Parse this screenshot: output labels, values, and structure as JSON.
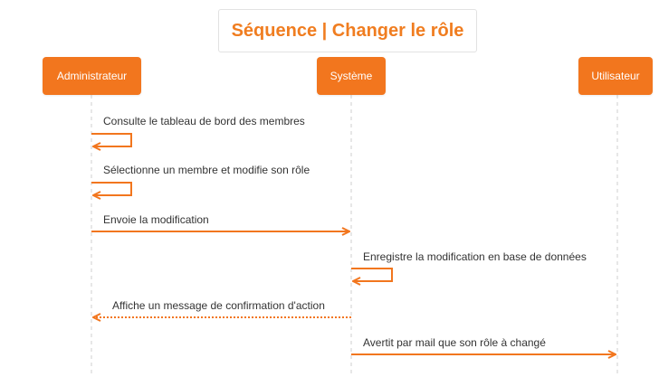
{
  "title": "Séquence | Changer le rôle",
  "participants": [
    {
      "id": "admin",
      "label": "Administrateur"
    },
    {
      "id": "system",
      "label": "Système"
    },
    {
      "id": "user",
      "label": "Utilisateur"
    }
  ],
  "messages": [
    {
      "from": "admin",
      "to": "admin",
      "type": "self",
      "style": "solid",
      "label": "Consulte le tableau de bord des membres"
    },
    {
      "from": "admin",
      "to": "admin",
      "type": "self",
      "style": "solid",
      "label": "Sélectionne un membre et modifie son rôle"
    },
    {
      "from": "admin",
      "to": "system",
      "type": "call",
      "style": "solid",
      "label": "Envoie la modification"
    },
    {
      "from": "system",
      "to": "system",
      "type": "self",
      "style": "solid",
      "label": "Enregistre la modification en base de données"
    },
    {
      "from": "system",
      "to": "admin",
      "type": "return",
      "style": "dotted",
      "label": "Affiche un message de confirmation d'action"
    },
    {
      "from": "system",
      "to": "user",
      "type": "call",
      "style": "solid",
      "label": "Avertit par mail que son rôle à changé"
    }
  ],
  "colors": {
    "accent": "#f2761e",
    "title_text": "#f07d20",
    "lifeline": "#cfcfcf",
    "label_text": "#333333"
  }
}
